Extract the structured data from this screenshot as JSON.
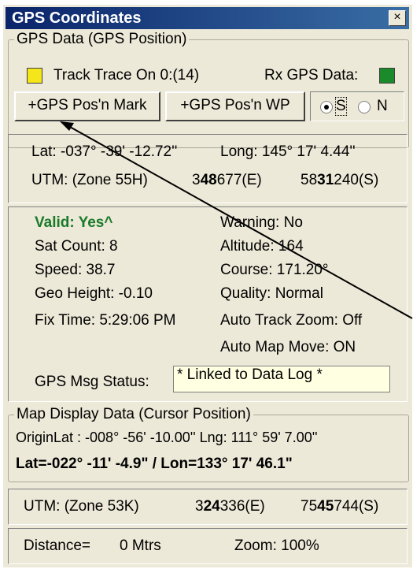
{
  "window": {
    "title": "GPS Coordinates",
    "close_glyph": "×"
  },
  "gps_data": {
    "legend": "GPS Data (GPS Position)",
    "track_trace_label": "Track Trace On 0:(14)",
    "track_color": "#f5e61a",
    "rx_label": "Rx GPS Data:",
    "rx_color": "#1a8a2a",
    "buttons": {
      "pos_mark": "+GPS Pos'n Mark",
      "pos_wp": "+GPS Pos'n WP"
    },
    "hemisphere": {
      "s_label": "S",
      "n_label": "N",
      "selected": "S"
    }
  },
  "position": {
    "lat": "Lat: -037° -39' -12.72''",
    "long": "Long: 145° 17' 4.44''",
    "utm_zone": "UTM: (Zone 55H)",
    "easting_pre": "3",
    "easting_bold": "48",
    "easting_post": "677(E)",
    "northing_pre": "58",
    "northing_bold": "31",
    "northing_post": "240(S)"
  },
  "status": {
    "valid": "Valid: Yes^",
    "warning": "Warning: No",
    "sat_count": "Sat Count: 8",
    "altitude": "Altitude: 164",
    "speed": "Speed: 38.7",
    "course": "Course: 171.20°",
    "geo_height": "Geo Height: -0.10",
    "quality": "Quality: Normal",
    "fix_time": "Fix Time: 5:29:06 PM",
    "auto_track_zoom": "Auto Track Zoom: Off",
    "auto_map_move": "Auto Map Move: ON",
    "msg_label": "GPS Msg Status:",
    "msg_value": "* Linked to Data Log *"
  },
  "map_display": {
    "legend": "Map Display Data (Cursor Position)",
    "origin": "OriginLat : -008° -56' -10.00''  Lng: 111° 59' 7.00''",
    "cursor": "Lat=-022° -11' -4.9\" / Lon=133° 17' 46.1\"",
    "utm_zone": "UTM: (Zone 53K)",
    "easting_pre": "3",
    "easting_bold": "24",
    "easting_post": "336(E)",
    "northing_pre": "75",
    "northing_bold": "45",
    "northing_post": "744(S)",
    "distance_label": "Distance=",
    "distance_value": "0 Mtrs",
    "zoom": "Zoom: 100%"
  }
}
